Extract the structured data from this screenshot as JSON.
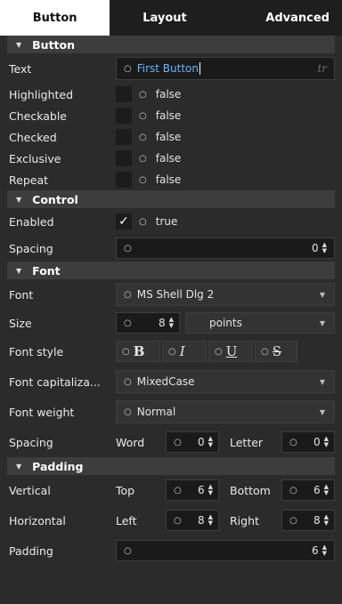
{
  "tabs": [
    "Button",
    "Layout",
    "Advanced"
  ],
  "sections": {
    "button": "Button",
    "control": "Control",
    "font": "Font",
    "padding": "Padding"
  },
  "button": {
    "text_label": "Text",
    "text_value": "First Button",
    "tr_icon": "tr",
    "props": [
      {
        "label": "Highlighted",
        "value": "false"
      },
      {
        "label": "Checkable",
        "value": "false"
      },
      {
        "label": "Checked",
        "value": "false"
      },
      {
        "label": "Exclusive",
        "value": "false"
      },
      {
        "label": "Repeat",
        "value": "false"
      }
    ]
  },
  "control": {
    "enabled_label": "Enabled",
    "enabled_value": "true",
    "spacing_label": "Spacing",
    "spacing_value": "0"
  },
  "font": {
    "font_label": "Font",
    "font_value": "MS Shell Dlg 2",
    "size_label": "Size",
    "size_value": "8",
    "size_unit": "points",
    "style_label": "Font style",
    "style_bold": "B",
    "style_italic": "I",
    "style_underline": "U",
    "style_strike": "S",
    "cap_label": "Font capitaliza...",
    "cap_value": "MixedCase",
    "weight_label": "Font weight",
    "weight_value": "Normal",
    "spacing_label": "Spacing",
    "word_label": "Word",
    "word_value": "0",
    "letter_label": "Letter",
    "letter_value": "0"
  },
  "padding": {
    "vertical_label": "Vertical",
    "top_label": "Top",
    "top_value": "6",
    "bottom_label": "Bottom",
    "bottom_value": "6",
    "horizontal_label": "Horizontal",
    "left_label": "Left",
    "left_value": "8",
    "right_label": "Right",
    "right_value": "8",
    "padding_label": "Padding",
    "padding_value": "6"
  }
}
